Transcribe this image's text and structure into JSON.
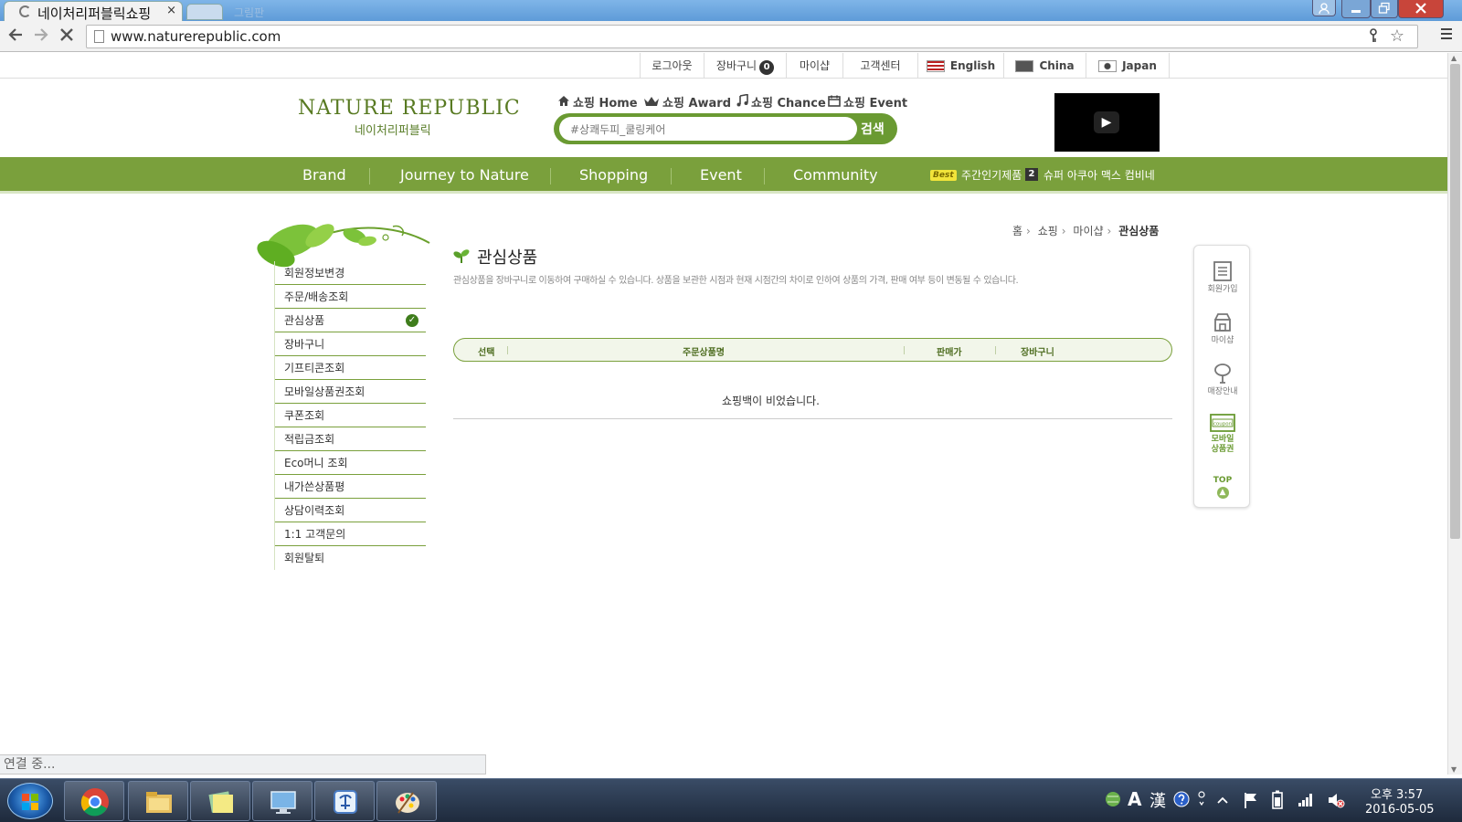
{
  "browser": {
    "tab_title": "네이처리퍼블릭쇼핑",
    "tab_close": "×",
    "ghost_tab": "그림판",
    "url": "www.naturerepublic.com",
    "loading_status": "연결 중..."
  },
  "util_nav": {
    "logout": "로그아웃",
    "cart": "장바구니",
    "cart_count": "0",
    "myshop": "마이샵",
    "customer_center": "고객센터",
    "lang_en": "English",
    "lang_cn": "China",
    "lang_jp": "Japan"
  },
  "header": {
    "logo_en": "NATURE REPUBLIC",
    "logo_ko": "네이처리퍼블릭",
    "shop_nav": [
      {
        "label": "쇼핑 Home",
        "icon": "home-icon"
      },
      {
        "label": "쇼핑 Award",
        "icon": "crown-icon"
      },
      {
        "label": "쇼핑 Chance",
        "icon": "music-note-icon"
      },
      {
        "label": "쇼핑 Event",
        "icon": "calendar-icon"
      }
    ],
    "search_value": "#상쾌두피_쿨링케어",
    "search_button": "검색"
  },
  "gnb": {
    "items": [
      "Brand",
      "Journey to Nature",
      "Shopping",
      "Event",
      "Community"
    ],
    "best_badge": "Best",
    "best_label": "주간인기제품",
    "rank_num": "2",
    "rank_text": "슈퍼 아쿠아 맥스 컴비네"
  },
  "sidebar": {
    "items": [
      "회원정보변경",
      "주문/배송조회",
      "관심상품",
      "장바구니",
      "기프티콘조회",
      "모바일상품권조회",
      "쿠폰조회",
      "적립금조회",
      "Eco머니 조회",
      "내가쓴상품평",
      "상담이력조회",
      "1:1 고객문의",
      "회원탈퇴"
    ],
    "active_index": 2
  },
  "main": {
    "breadcrumb": [
      "홈",
      "쇼핑",
      "마이샵",
      "관심상품"
    ],
    "title": "관심상품",
    "description": "관심상품을 장바구니로 이동하여 구매하실 수 있습니다. 상품을 보관한 시점과 현재 시점간의 차이로 인하여 상품의 가격, 판매 여부 등이 변동될 수 있습니다.",
    "table_headers": [
      "선택",
      "주문상품명",
      "판매가",
      "장바구니"
    ],
    "empty_message": "쇼핑백이 비었습니다."
  },
  "quick_menu": {
    "join": "회원가입",
    "myshop": "마이샵",
    "store": "매장안내",
    "coupon_icon_text": "coupon",
    "mobile_voucher_line1": "모바일",
    "mobile_voucher_line2": "상품권",
    "top": "TOP"
  },
  "taskbar": {
    "clock_time": "오후 3:57",
    "clock_date": "2016-05-05",
    "ime_a": "A",
    "ime_han": "漢"
  },
  "colors": {
    "brand_green": "#7aa03c",
    "dark_green": "#587a22"
  }
}
